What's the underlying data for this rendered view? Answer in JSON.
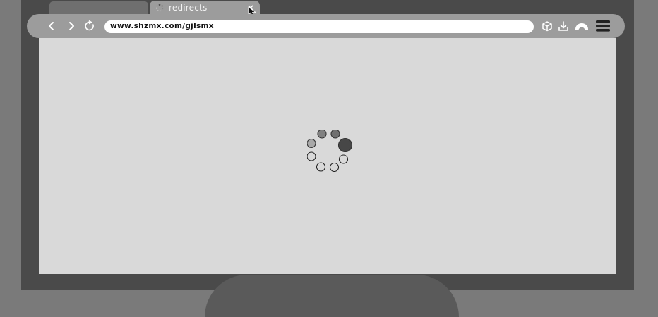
{
  "browser": {
    "tab": {
      "title": "redirects",
      "close_label": "×"
    },
    "address_bar": {
      "url": "www.shzmx.com/gjlsmx"
    }
  },
  "icons": {
    "back": "chevron-left-icon",
    "forward": "chevron-right-icon",
    "reload": "reload-icon",
    "extensions": "cube-icon",
    "downloads": "download-icon",
    "profile": "profile-icon",
    "menu": "hamburger-menu-icon",
    "favicon": "loading-favicon-icon",
    "cursor": "mouse-pointer-icon"
  },
  "page": {
    "state": "loading"
  },
  "colors": {
    "page_background": "#d9d9d9",
    "chrome": "#9c9c9c",
    "spinner_active": "#444444"
  }
}
